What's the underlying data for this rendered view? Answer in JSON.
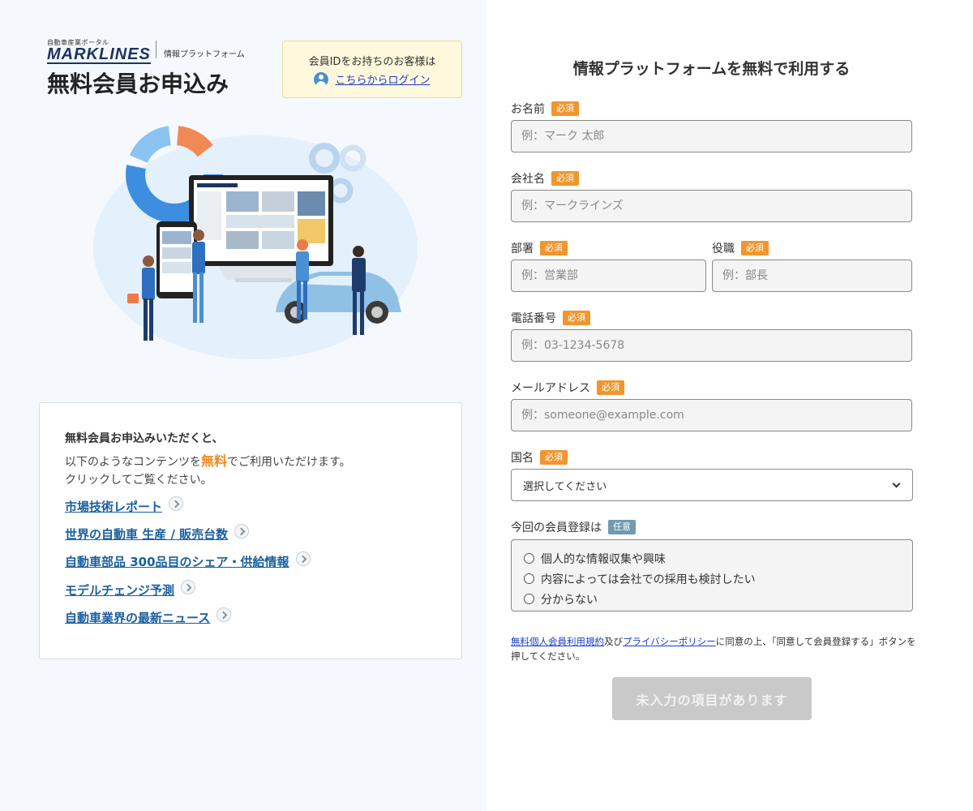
{
  "header": {
    "logo_small": "自動車産業ポータル",
    "logo_main": "MARKLINES",
    "logo_platform": "情報プラットフォーム",
    "page_title": "無料会員お申込み"
  },
  "login": {
    "question": "会員IDをお持ちのお客様は",
    "link": "こちらからログイン"
  },
  "info": {
    "lead": "無料会員お申込みいただくと、",
    "line2_before": "以下のようなコンテンツを",
    "line2_free": "無料",
    "line2_after": "でご利用いただけます。",
    "line3": "クリックしてご覧ください。",
    "links": [
      "市場技術レポート",
      "世界の自動車 生産 / 販売台数",
      "自動車部品 300品目のシェア・供給情報",
      "モデルチェンジ予測",
      "自動車業界の最新ニュース"
    ]
  },
  "form": {
    "title": "情報プラットフォームを無料で利用する",
    "required_badge": "必須",
    "optional_badge": "任意",
    "fields": {
      "name": {
        "label": "お名前",
        "placeholder": "例：マーク 太郎"
      },
      "company": {
        "label": "会社名",
        "placeholder": "例：マークラインズ"
      },
      "department": {
        "label": "部署",
        "placeholder": "例：営業部"
      },
      "position": {
        "label": "役職",
        "placeholder": "例：部長"
      },
      "phone": {
        "label": "電話番号",
        "placeholder": "例：03-1234-5678"
      },
      "email": {
        "label": "メールアドレス",
        "placeholder": "例：someone@example.com"
      },
      "country": {
        "label": "国名",
        "selected": "選択してください"
      }
    },
    "registration": {
      "label": "今回の会員登録は",
      "options": [
        "個人的な情報収集や興味",
        "内容によっては会社での採用も検討したい",
        "分からない"
      ]
    },
    "terms": {
      "link1": "無料個人会員利用規約",
      "and": "及び",
      "link2": "プライバシーポリシー",
      "rest": "に同意の上、「同意して会員登録する」ボタンを押してください。"
    },
    "submit": "未入力の項目があります"
  },
  "colors": {
    "required": "#f0962e",
    "optional": "#6f9bb0",
    "link": "#1a5fa0",
    "free": "#f08a24",
    "left_bg": "#f5f9fd"
  }
}
